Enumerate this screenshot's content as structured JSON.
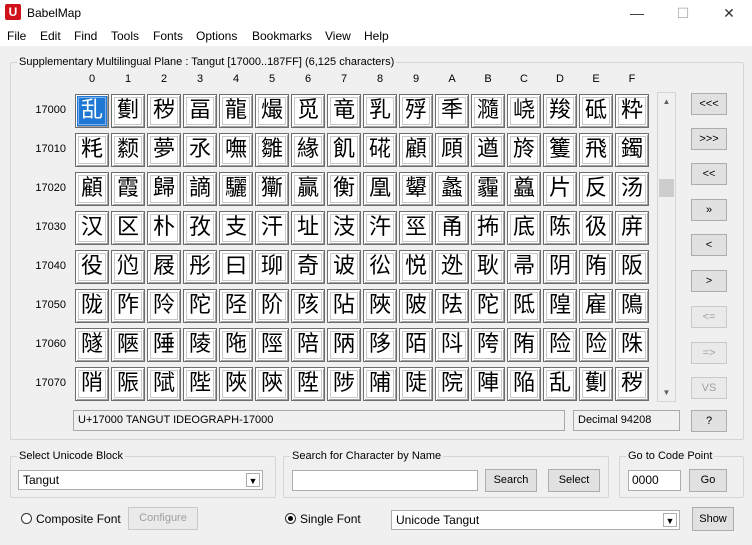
{
  "window": {
    "title": "BabelMap",
    "app_icon": "U",
    "minimize": "—",
    "maximize": "☐",
    "close": "✕"
  },
  "menu": [
    "File",
    "Edit",
    "Find",
    "Tools",
    "Fonts",
    "Options",
    "Bookmarks",
    "View",
    "Help"
  ],
  "grid": {
    "caption": "Supplementary Multilingual Plane : Tangut [17000..187FF] (6,125 characters)",
    "columns": [
      "0",
      "1",
      "2",
      "3",
      "4",
      "5",
      "6",
      "7",
      "8",
      "9",
      "A",
      "B",
      "C",
      "D",
      "E",
      "F"
    ],
    "rows": [
      "17000",
      "17010",
      "17020",
      "17030",
      "17040",
      "17050",
      "17060",
      "17070"
    ],
    "glyph_font": "Tangut",
    "selected_cell": "17000"
  },
  "nav_buttons": [
    "<<<",
    ">>>",
    "<<",
    "»",
    "<",
    ">",
    "<=",
    "=>",
    "VS",
    "?"
  ],
  "status": {
    "character": "U+17000 TANGUT IDEOGRAPH-17000",
    "decimal": "Decimal 94208"
  },
  "select_block": {
    "label": "Select Unicode Block",
    "value": "Tangut"
  },
  "search": {
    "label": "Search for Character by Name",
    "value": "",
    "search_button": "Search",
    "select_button": "Select"
  },
  "goto": {
    "label": "Go to Code Point",
    "value": "0000",
    "go_button": "Go"
  },
  "font_mode": {
    "composite_label": "Composite Font",
    "configure_button": "Configure",
    "single_label": "Single Font",
    "selected": "single",
    "font_value": "Unicode Tangut",
    "show_button": "Show"
  }
}
